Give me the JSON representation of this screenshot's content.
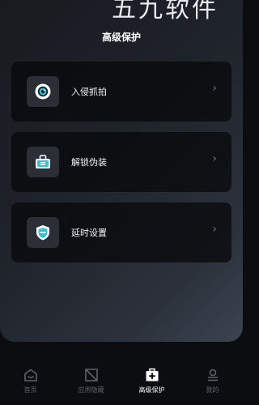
{
  "brand_watermark": "五九软件",
  "page_title": "高级保护",
  "cards": [
    {
      "label": "入侵抓拍",
      "icon": "camera-lens-icon"
    },
    {
      "label": "解锁伪装",
      "icon": "briefcase-icon"
    },
    {
      "label": "延时设置",
      "icon": "shield-icon"
    }
  ],
  "chevron": "›",
  "tabs": [
    {
      "label": "首页",
      "icon": "home-icon",
      "active": false
    },
    {
      "label": "应用隐藏",
      "icon": "hide-app-icon",
      "active": false
    },
    {
      "label": "高级保护",
      "icon": "medical-plus-icon",
      "active": true
    },
    {
      "label": "我的",
      "icon": "profile-icon",
      "active": false
    }
  ],
  "colors": {
    "accent": "#36c2d4",
    "card_bg": "#0a0b0e",
    "icon_box_bg": "#2b2e35"
  }
}
